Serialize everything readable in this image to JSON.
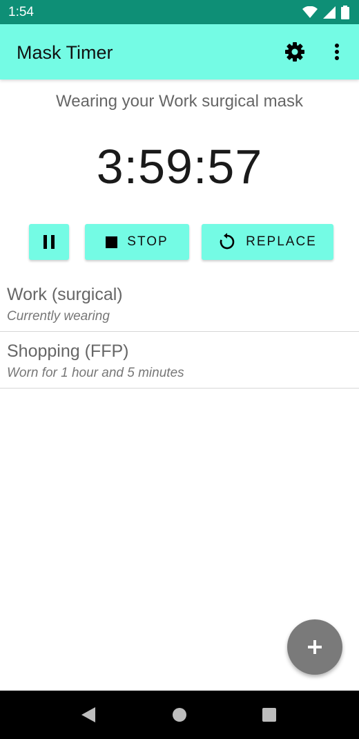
{
  "status_bar": {
    "time": "1:54"
  },
  "app_bar": {
    "title": "Mask Timer",
    "settings_icon": "gear-icon",
    "overflow_icon": "more-vert-icon"
  },
  "main": {
    "subtitle": "Wearing your Work surgical mask",
    "timer": "3:59:57",
    "buttons": {
      "pause_icon": "pause-icon",
      "stop_label": "STOP",
      "replace_label": "REPLACE"
    }
  },
  "masks": [
    {
      "name": "Work (surgical)",
      "status": "Currently wearing"
    },
    {
      "name": "Shopping (FFP)",
      "status": "Worn for 1 hour and 5 minutes"
    }
  ],
  "fab": {
    "icon": "add-icon"
  },
  "colors": {
    "status_bar": "#0e8f76",
    "accent": "#74fbe4",
    "fab": "#7a7a7a"
  }
}
